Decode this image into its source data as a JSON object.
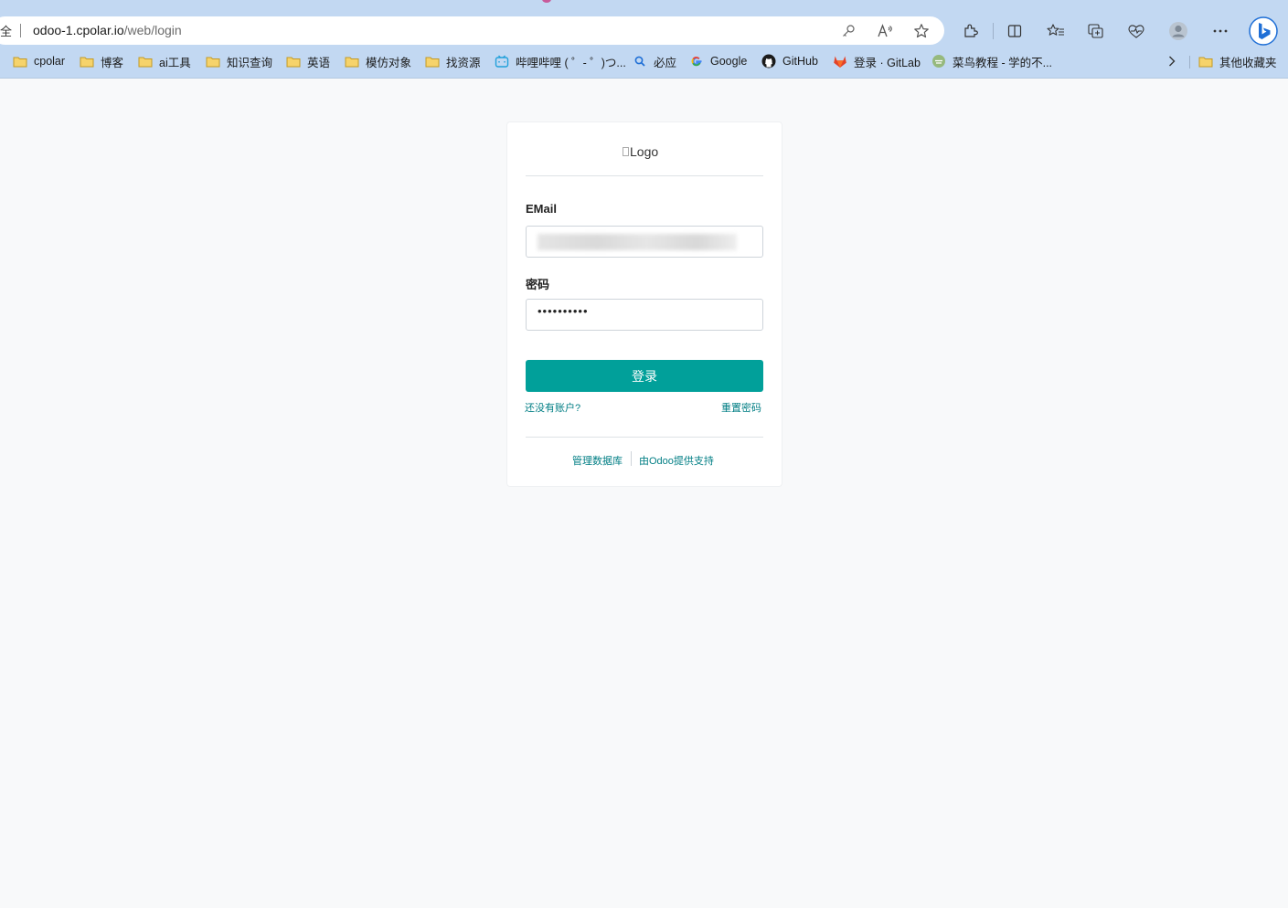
{
  "browser": {
    "address_edge_text": "全",
    "url_host": "odoo-1.cpolar.io",
    "url_path": "/web/login",
    "accent_color": "#c2d8f2"
  },
  "bookmarks": [
    {
      "label": "cpolar",
      "icon": "folder-icon"
    },
    {
      "label": "博客",
      "icon": "folder-icon"
    },
    {
      "label": "ai工具",
      "icon": "folder-icon"
    },
    {
      "label": "知识查询",
      "icon": "folder-icon"
    },
    {
      "label": "英语",
      "icon": "folder-icon"
    },
    {
      "label": "模仿对象",
      "icon": "folder-icon"
    },
    {
      "label": "找资源",
      "icon": "folder-icon"
    },
    {
      "label": "哔哩哔哩 ( ゜- ゜)つ...",
      "icon": "bilibili-icon"
    },
    {
      "label": "必应",
      "icon": "search-icon"
    },
    {
      "label": "Google",
      "icon": "google-icon"
    },
    {
      "label": "GitHub",
      "icon": "github-icon"
    },
    {
      "label": "登录 · GitLab",
      "icon": "gitlab-icon"
    },
    {
      "label": "菜鸟教程 - 学的不...",
      "icon": "runoob-icon"
    },
    {
      "label": "其他收藏夹",
      "icon": "folder-icon"
    }
  ],
  "login": {
    "logo_alt": "Logo",
    "email_label": "EMail",
    "password_label": "密码",
    "password_value": "••••••••••",
    "submit_label": "登录",
    "signup_link": "还没有账户?",
    "reset_link": "重置密码",
    "manage_db_link": "管理数据库",
    "powered_by_link": "由Odoo提供支持",
    "primary_color": "#01a09a",
    "link_color": "#017e84"
  }
}
